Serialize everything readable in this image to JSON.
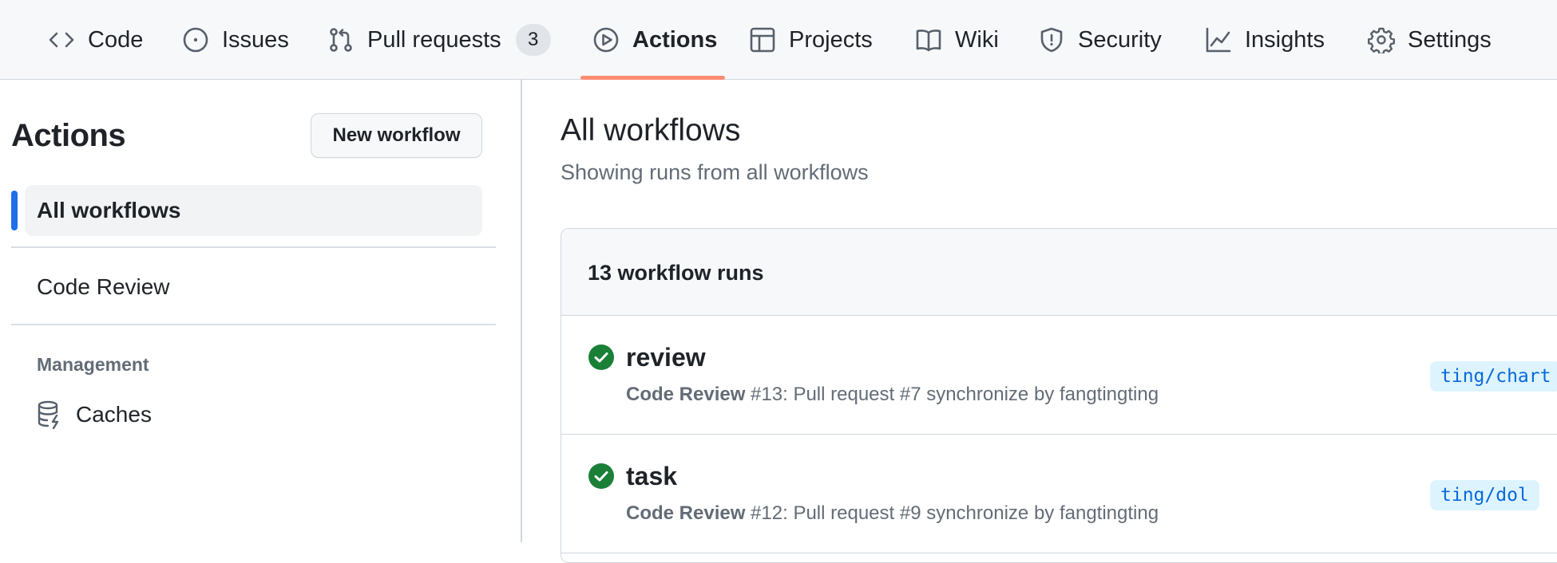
{
  "nav": {
    "tabs": [
      {
        "label": "Code",
        "icon": "code-icon"
      },
      {
        "label": "Issues",
        "icon": "issue-opened-icon"
      },
      {
        "label": "Pull requests",
        "icon": "git-pull-request-icon",
        "count": "3"
      },
      {
        "label": "Actions",
        "icon": "play-icon",
        "active": true
      },
      {
        "label": "Projects",
        "icon": "table-icon"
      },
      {
        "label": "Wiki",
        "icon": "book-icon"
      },
      {
        "label": "Security",
        "icon": "shield-icon"
      },
      {
        "label": "Insights",
        "icon": "graph-icon"
      },
      {
        "label": "Settings",
        "icon": "gear-icon"
      }
    ],
    "active_underline_color": "#fd8c73"
  },
  "sidebar": {
    "title": "Actions",
    "new_workflow_label": "New workflow",
    "items": [
      {
        "label": "All workflows",
        "active": true
      },
      {
        "label": "Code Review"
      }
    ],
    "section_label": "Management",
    "caches": {
      "label": "Caches",
      "icon": "database-icon"
    }
  },
  "main": {
    "title": "All workflows",
    "subtitle": "Showing runs from all workflows",
    "runs_count": "13 workflow runs",
    "runs": [
      {
        "status": "success",
        "title": "review",
        "workflow": "Code Review",
        "detail": " #13: Pull request #7 synchronize by fangtingting",
        "branch": "ting/chart"
      },
      {
        "status": "success",
        "title": "task",
        "workflow": "Code Review",
        "detail": " #12: Pull request #9 synchronize by fangtingting",
        "branch": "ting/dol"
      }
    ]
  },
  "colors": {
    "success": "#1a7f37",
    "accent": "#1f6feb",
    "branch_bg": "#ddf4ff",
    "branch_fg": "#0969da"
  }
}
